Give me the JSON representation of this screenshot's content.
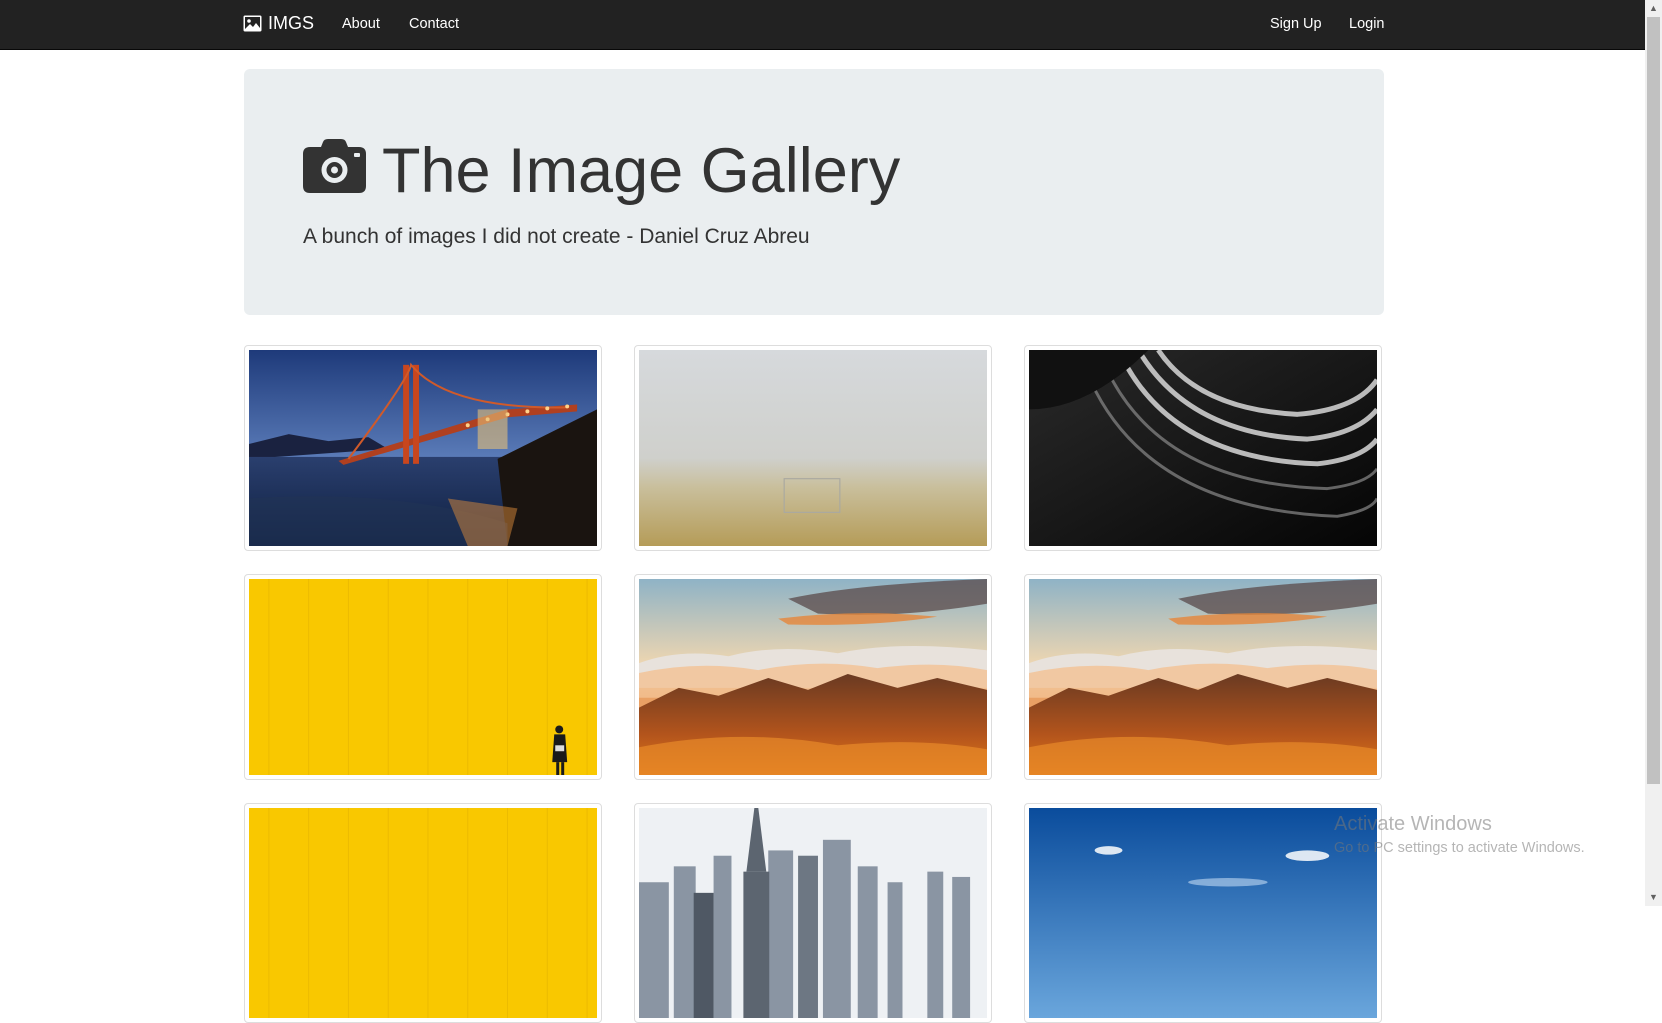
{
  "navbar": {
    "brand_label": "IMGS",
    "brand_icon": "picture-icon",
    "links": [
      {
        "label": "About"
      },
      {
        "label": "Contact"
      }
    ],
    "right_links": [
      {
        "label": "Sign Up"
      },
      {
        "label": "Login"
      }
    ]
  },
  "jumbotron": {
    "icon": "camera-icon",
    "title": "The Image Gallery",
    "subtitle": "A bunch of images I did not create - Daniel Cruz Abreu"
  },
  "gallery": {
    "images": [
      {
        "subject": "golden-gate-bridge-night"
      },
      {
        "subject": "foggy-soccer-field"
      },
      {
        "subject": "abstract-black-white-architecture"
      },
      {
        "subject": "yellow-wall-person"
      },
      {
        "subject": "mountains-sunset-clouds"
      },
      {
        "subject": "mountains-sunset-clouds"
      },
      {
        "subject": "yellow-wall"
      },
      {
        "subject": "city-skyline"
      },
      {
        "subject": "blue-sky"
      }
    ]
  },
  "watermark": {
    "title": "Activate Windows",
    "subtitle": "Go to PC settings to activate Windows."
  },
  "colors": {
    "navbar_bg": "#222222",
    "jumbotron_bg": "#eaeef0"
  }
}
